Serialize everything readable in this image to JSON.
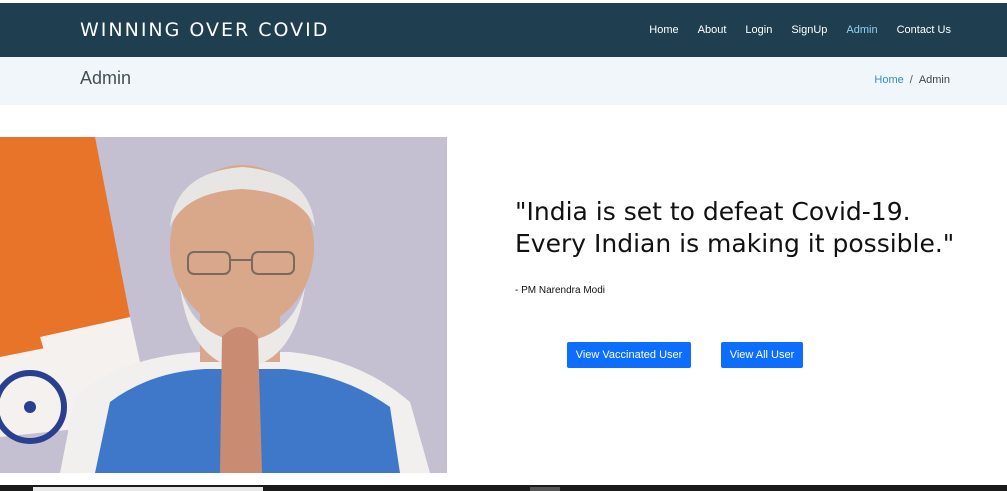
{
  "navbar": {
    "brand": "WINNING OVER COVID",
    "links": [
      {
        "label": "Home"
      },
      {
        "label": "About"
      },
      {
        "label": "Login"
      },
      {
        "label": "SignUp"
      },
      {
        "label": "Admin",
        "active": true
      },
      {
        "label": "Contact Us"
      }
    ],
    "background_color": "#1f3f51",
    "active_link_color": "#8fd1f0"
  },
  "page_header": {
    "title": "Admin",
    "breadcrumb": {
      "home": "Home",
      "separator": "/",
      "current": "Admin"
    }
  },
  "hero": {
    "quote": "\"India is set to defeat Covid-19. Every Indian is making it possible.\"",
    "attribution": "- PM Narendra Modi",
    "buttons": {
      "view_vaccinated": "View Vaccinated User",
      "view_all": "View All User"
    },
    "button_color": "#0d6efd"
  }
}
